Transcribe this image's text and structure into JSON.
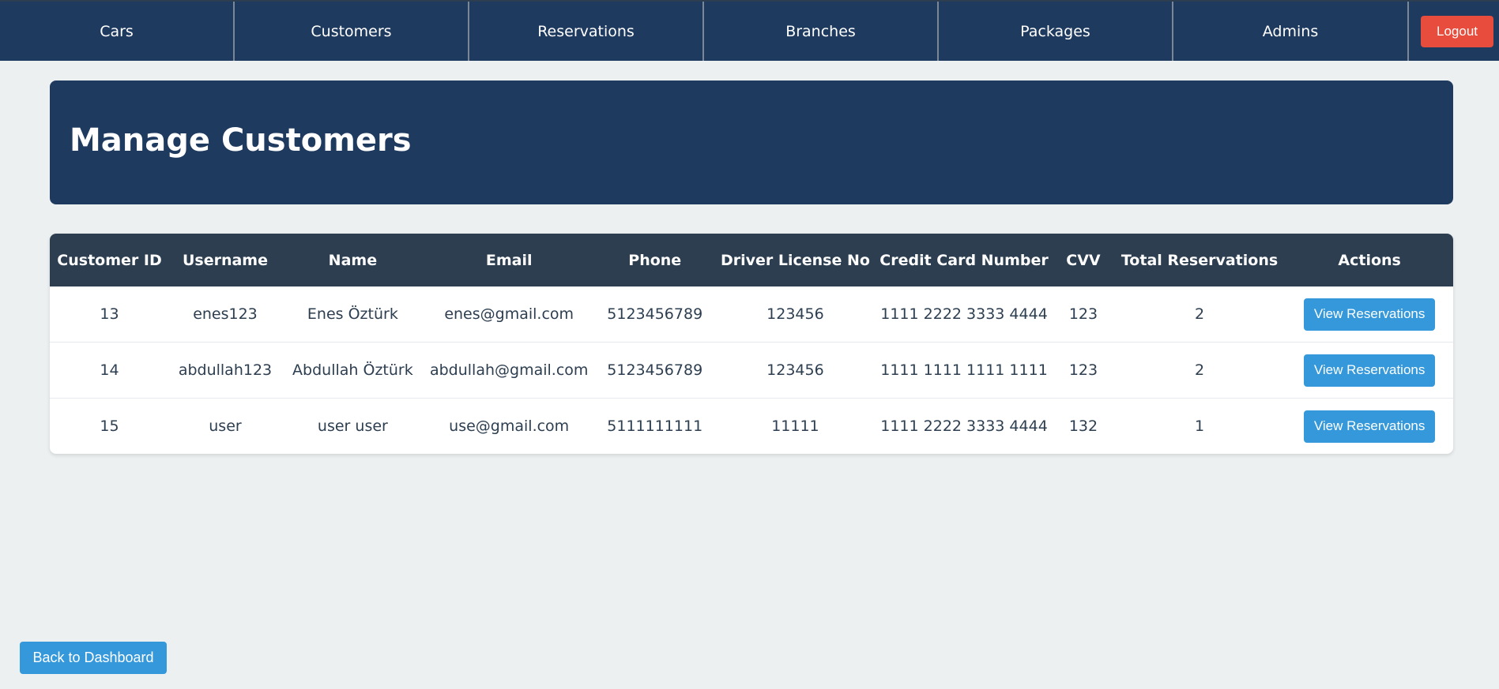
{
  "nav": {
    "items": [
      {
        "label": "Cars"
      },
      {
        "label": "Customers"
      },
      {
        "label": "Reservations"
      },
      {
        "label": "Branches"
      },
      {
        "label": "Packages"
      },
      {
        "label": "Admins"
      }
    ],
    "logout_label": "Logout"
  },
  "header": {
    "title": "Manage Customers"
  },
  "table": {
    "columns": [
      "Customer ID",
      "Username",
      "Name",
      "Email",
      "Phone",
      "Driver License No",
      "Credit Card Number",
      "CVV",
      "Total Reservations",
      "Actions"
    ],
    "rows": [
      {
        "customer_id": "13",
        "username": "enes123",
        "name": "Enes Öztürk",
        "email": "enes@gmail.com",
        "phone": "5123456789",
        "license": "123456",
        "card": "1111 2222 3333 4444",
        "cvv": "123",
        "total": "2",
        "action_label": "View Reservations"
      },
      {
        "customer_id": "14",
        "username": "abdullah123",
        "name": "Abdullah Öztürk",
        "email": "abdullah@gmail.com",
        "phone": "5123456789",
        "license": "123456",
        "card": "1111 1111 1111 1111",
        "cvv": "123",
        "total": "2",
        "action_label": "View Reservations"
      },
      {
        "customer_id": "15",
        "username": "user",
        "name": "user user",
        "email": "use@gmail.com",
        "phone": "5111111111",
        "license": "11111",
        "card": "1111 2222 3333 4444",
        "cvv": "132",
        "total": "1",
        "action_label": "View Reservations"
      }
    ]
  },
  "footer": {
    "back_label": "Back to Dashboard"
  },
  "colors": {
    "nav_bg": "#1f3a5f",
    "table_header_bg": "#2c3e50",
    "page_bg": "#ecf0f1",
    "primary_button": "#3498db",
    "danger_button": "#e74c3c"
  }
}
